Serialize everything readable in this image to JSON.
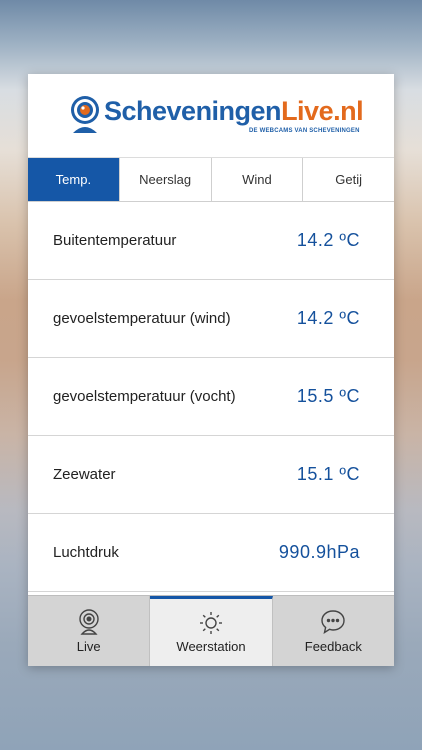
{
  "brand": {
    "name_part1": "Scheveningen",
    "name_part2": "Live.nl",
    "tagline": "DE WEBCAMS VAN SCHEVENINGEN",
    "colors": {
      "primary": "#1557a7",
      "accent": "#e36a1d"
    }
  },
  "tabs": [
    {
      "label": "Temp.",
      "active": true
    },
    {
      "label": "Neerslag",
      "active": false
    },
    {
      "label": "Wind",
      "active": false
    },
    {
      "label": "Getij",
      "active": false
    }
  ],
  "rows": [
    {
      "label": "Buitentemperatuur",
      "value": "14.2 ºC"
    },
    {
      "label": "gevoelstemperatuur (wind)",
      "value": "14.2 ºC"
    },
    {
      "label": "gevoelstemperatuur (vocht)",
      "value": "15.5 ºC"
    },
    {
      "label": "Zeewater",
      "value": "15.1 ºC"
    },
    {
      "label": "Luchtdruk",
      "value": "990.9hPa"
    }
  ],
  "bottom_nav": [
    {
      "label": "Live",
      "icon": "webcam-icon",
      "active": false
    },
    {
      "label": "Weerstation",
      "icon": "sun-icon",
      "active": true
    },
    {
      "label": "Feedback",
      "icon": "chat-bubble-icon",
      "active": false
    }
  ]
}
